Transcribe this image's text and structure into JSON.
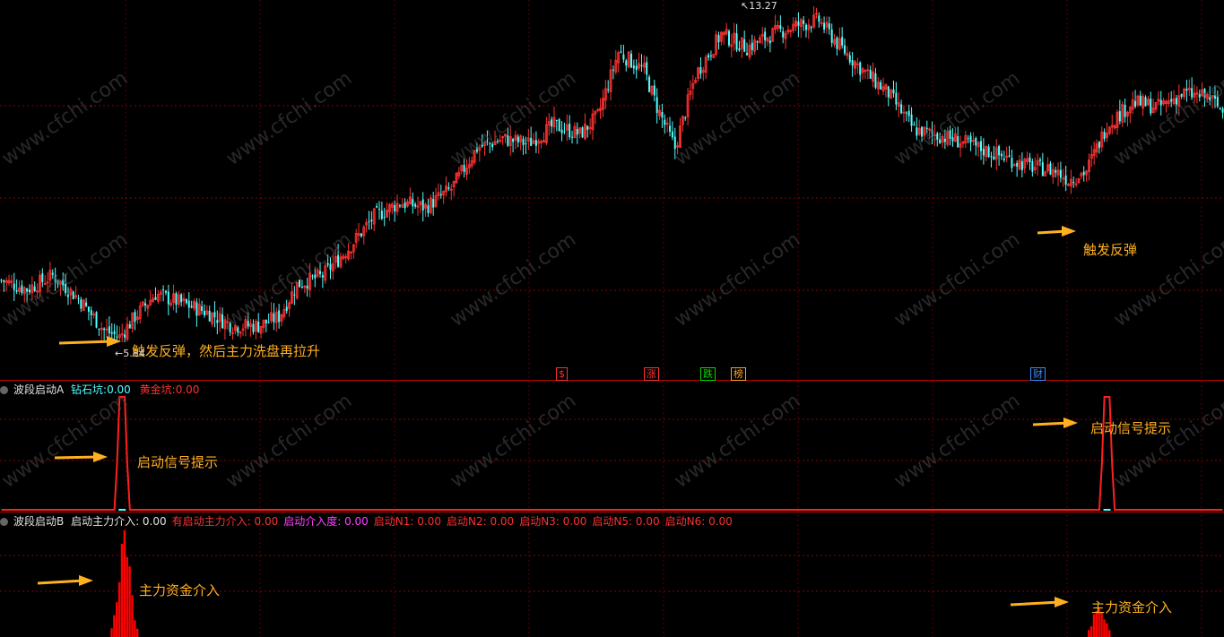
{
  "colors": {
    "background": "#000000",
    "grid": "#8B0000",
    "up_candle": "#FF3232",
    "down_candle": "#54FFFF",
    "signal_line": "#FF2020",
    "annotation": "#FFB020",
    "label_white": "#E0E0E0"
  },
  "main_panel": {
    "high_label": "13.27",
    "low_label": "5.84",
    "markers": [
      {
        "text": "$",
        "color": "#FF3030"
      },
      {
        "text": "涨",
        "color": "#FF3030"
      },
      {
        "text": "跌",
        "color": "#00DD00"
      },
      {
        "text": "榜",
        "color": "#FFA020"
      },
      {
        "text": "财",
        "color": "#3C8CFF"
      }
    ],
    "annotations": {
      "left": "触发反弹，然后主力洗盘再拉升",
      "right": "触发反弹"
    }
  },
  "panel_a": {
    "title": "波段启动A",
    "field1_label": "钻石坑:",
    "field1_value": "0.00",
    "field2_label": "黄金坑:",
    "field2_value": "0.00",
    "annotation_left": "启动信号提示",
    "annotation_right": "启动信号提示"
  },
  "panel_b": {
    "title": "波段启动B",
    "fields": [
      {
        "label": "启动主力介入:",
        "value": "0.00",
        "color": "#E0E0E0"
      },
      {
        "label": "有启动主力介入:",
        "value": "0.00",
        "color": "#FF3030"
      },
      {
        "label": "启动介入度:",
        "value": "0.00",
        "color": "#FF40FF"
      },
      {
        "label": "启动N1:",
        "value": "0.00",
        "color": "#FF3030"
      },
      {
        "label": "启动N2:",
        "value": "0.00",
        "color": "#FF3030"
      },
      {
        "label": "启动N3:",
        "value": "0.00",
        "color": "#FF3030"
      },
      {
        "label": "启动N5:",
        "value": "0.00",
        "color": "#FF3030"
      },
      {
        "label": "启动N6:",
        "value": "0.00",
        "color": "#FF3030"
      }
    ],
    "annotation_left": "主力资金介入",
    "annotation_right": "主力资金介入"
  },
  "watermark": "www.cfchi.com",
  "chart_data": {
    "type": "candlestick",
    "y_range": [
      5.84,
      13.27
    ],
    "close_anchors": [
      [
        0,
        7.2
      ],
      [
        10,
        7.0
      ],
      [
        20,
        7.3
      ],
      [
        30,
        6.8
      ],
      [
        40,
        6.1
      ],
      [
        46,
        5.95
      ],
      [
        52,
        6.4
      ],
      [
        60,
        6.9
      ],
      [
        70,
        6.7
      ],
      [
        80,
        6.5
      ],
      [
        90,
        6.2
      ],
      [
        100,
        6.2
      ],
      [
        108,
        6.4
      ],
      [
        115,
        7.1
      ],
      [
        125,
        7.3
      ],
      [
        135,
        7.9
      ],
      [
        145,
        8.6
      ],
      [
        155,
        8.9
      ],
      [
        165,
        8.8
      ],
      [
        175,
        9.2
      ],
      [
        185,
        10.1
      ],
      [
        195,
        10.3
      ],
      [
        205,
        10.2
      ],
      [
        215,
        10.6
      ],
      [
        225,
        10.4
      ],
      [
        232,
        10.8
      ],
      [
        240,
        12.2
      ],
      [
        250,
        11.8
      ],
      [
        255,
        11.0
      ],
      [
        262,
        10.1
      ],
      [
        270,
        11.7
      ],
      [
        280,
        12.6
      ],
      [
        290,
        12.3
      ],
      [
        300,
        12.6
      ],
      [
        310,
        12.8
      ],
      [
        318,
        12.9
      ],
      [
        325,
        12.4
      ],
      [
        335,
        11.8
      ],
      [
        345,
        11.3
      ],
      [
        355,
        10.5
      ],
      [
        370,
        10.3
      ],
      [
        385,
        10.0
      ],
      [
        400,
        9.7
      ],
      [
        410,
        9.6
      ],
      [
        415,
        9.4
      ],
      [
        422,
        9.6
      ],
      [
        430,
        10.6
      ],
      [
        440,
        11.1
      ],
      [
        450,
        11.0
      ],
      [
        460,
        11.3
      ],
      [
        470,
        11.2
      ],
      [
        475,
        10.9
      ]
    ],
    "panel_a_signal": {
      "range": [
        0,
        1
      ],
      "spikes_at_candle": [
        47,
        430
      ]
    },
    "panel_b_histogram": {
      "range": [
        0,
        1
      ],
      "clusters": [
        {
          "center_candle": 48,
          "peak": 1.0
        },
        {
          "center_candle": 427,
          "peak": 0.32
        }
      ]
    }
  }
}
